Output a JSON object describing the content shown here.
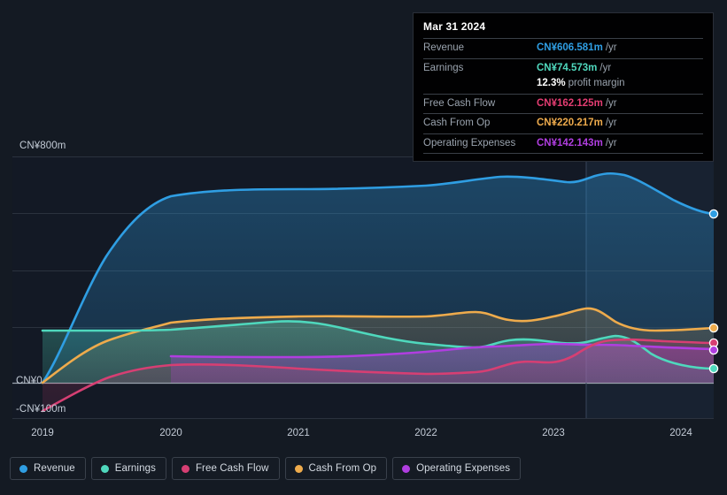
{
  "tooltip": {
    "date": "Mar 31 2024",
    "rows": [
      {
        "label": "Revenue",
        "value": "CN¥606.581m",
        "unit": "/yr",
        "color": "#2f9ee3"
      },
      {
        "label": "Earnings",
        "value": "CN¥74.573m",
        "unit": "/yr",
        "color": "#4fd8bd"
      },
      {
        "label": "",
        "value": "12.3%",
        "unit": "profit margin",
        "color": "#ffffff"
      },
      {
        "label": "Free Cash Flow",
        "value": "CN¥162.125m",
        "unit": "/yr",
        "color": "#e33d72"
      },
      {
        "label": "Cash From Op",
        "value": "CN¥220.217m",
        "unit": "/yr",
        "color": "#eeab4c"
      },
      {
        "label": "Operating Expenses",
        "value": "CN¥142.143m",
        "unit": "/yr",
        "color": "#b03ee0"
      }
    ]
  },
  "axes": {
    "y_top_label": "CN¥800m",
    "y_zero_label": "CN¥0",
    "y_neg_label": "-CN¥100m",
    "x_ticks": [
      "2019",
      "2020",
      "2021",
      "2022",
      "2023",
      "2024"
    ]
  },
  "legend": {
    "items": [
      {
        "label": "Revenue",
        "color": "#2f9ee3"
      },
      {
        "label": "Earnings",
        "color": "#4fd8bd"
      },
      {
        "label": "Free Cash Flow",
        "color": "#d63f73"
      },
      {
        "label": "Cash From Op",
        "color": "#eeab4c"
      },
      {
        "label": "Operating Expenses",
        "color": "#b03ee0"
      }
    ]
  },
  "chart_data": {
    "type": "area",
    "title": "",
    "xlabel": "",
    "ylabel": "CN¥",
    "ylim": [
      -100,
      800
    ],
    "y_ticks": [
      800,
      600,
      400,
      200,
      0,
      -100
    ],
    "grid": true,
    "legend_position": "bottom",
    "currency": "CN¥",
    "unit": "m",
    "x": [
      "2019",
      "2019.5",
      "2020",
      "2020.5",
      "2021",
      "2021.5",
      "2022",
      "2022.5",
      "2023",
      "2023.5",
      "2024",
      "2024.25"
    ],
    "series": [
      {
        "name": "Revenue",
        "color": "#2f9ee3",
        "values": [
          0,
          400,
          640,
          660,
          660,
          660,
          672,
          690,
          680,
          710,
          640,
          606.581
        ]
      },
      {
        "name": "Earnings",
        "color": "#4fd8bd",
        "values": [
          215,
          215,
          215,
          225,
          228,
          205,
          185,
          180,
          180,
          195,
          140,
          74.573
        ]
      },
      {
        "name": "Free Cash Flow",
        "color": "#d63f73",
        "values": [
          -100,
          -25,
          40,
          32,
          22,
          18,
          18,
          20,
          85,
          90,
          135,
          162.125
        ]
      },
      {
        "name": "Cash From Op",
        "color": "#eeab4c",
        "values": [
          0,
          130,
          212,
          225,
          230,
          230,
          235,
          250,
          226,
          262,
          226,
          220.217
        ]
      },
      {
        "name": "Operating Expenses",
        "color": "#b03ee0",
        "values": [
          null,
          null,
          95,
          92,
          92,
          100,
          108,
          110,
          120,
          130,
          138,
          142.143
        ]
      }
    ],
    "highlight_band": {
      "from": "2023.3",
      "to": "2024.25",
      "note": "latest period shading"
    },
    "end_markers": true
  }
}
